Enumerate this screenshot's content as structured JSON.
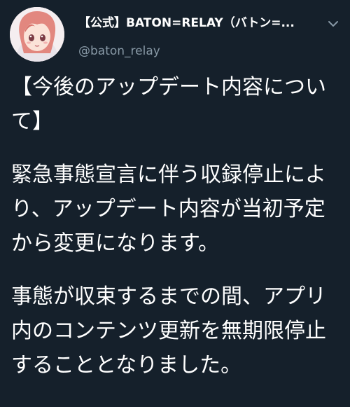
{
  "tweet": {
    "display_name": "【公式】BATON=RELAY（バトン=...",
    "handle": "@baton_relay",
    "avatar_icon": "avatar-anime-girl-icon",
    "more_icon": "chevron-down-icon",
    "paragraphs": [
      [
        "【今後のアップデート内容につい",
        "て】"
      ],
      [
        "緊急事態宣言に伴う収録停止によ",
        "り、アップデート内容が当初予定",
        "から変更になります。"
      ],
      [
        "事態が収束するまでの間、アプリ",
        "内のコンテンツ更新を無期限停止",
        "することとなりました。"
      ]
    ]
  },
  "colors": {
    "background": "#15202b",
    "text": "#ffffff",
    "secondary_text": "#8899a6"
  }
}
